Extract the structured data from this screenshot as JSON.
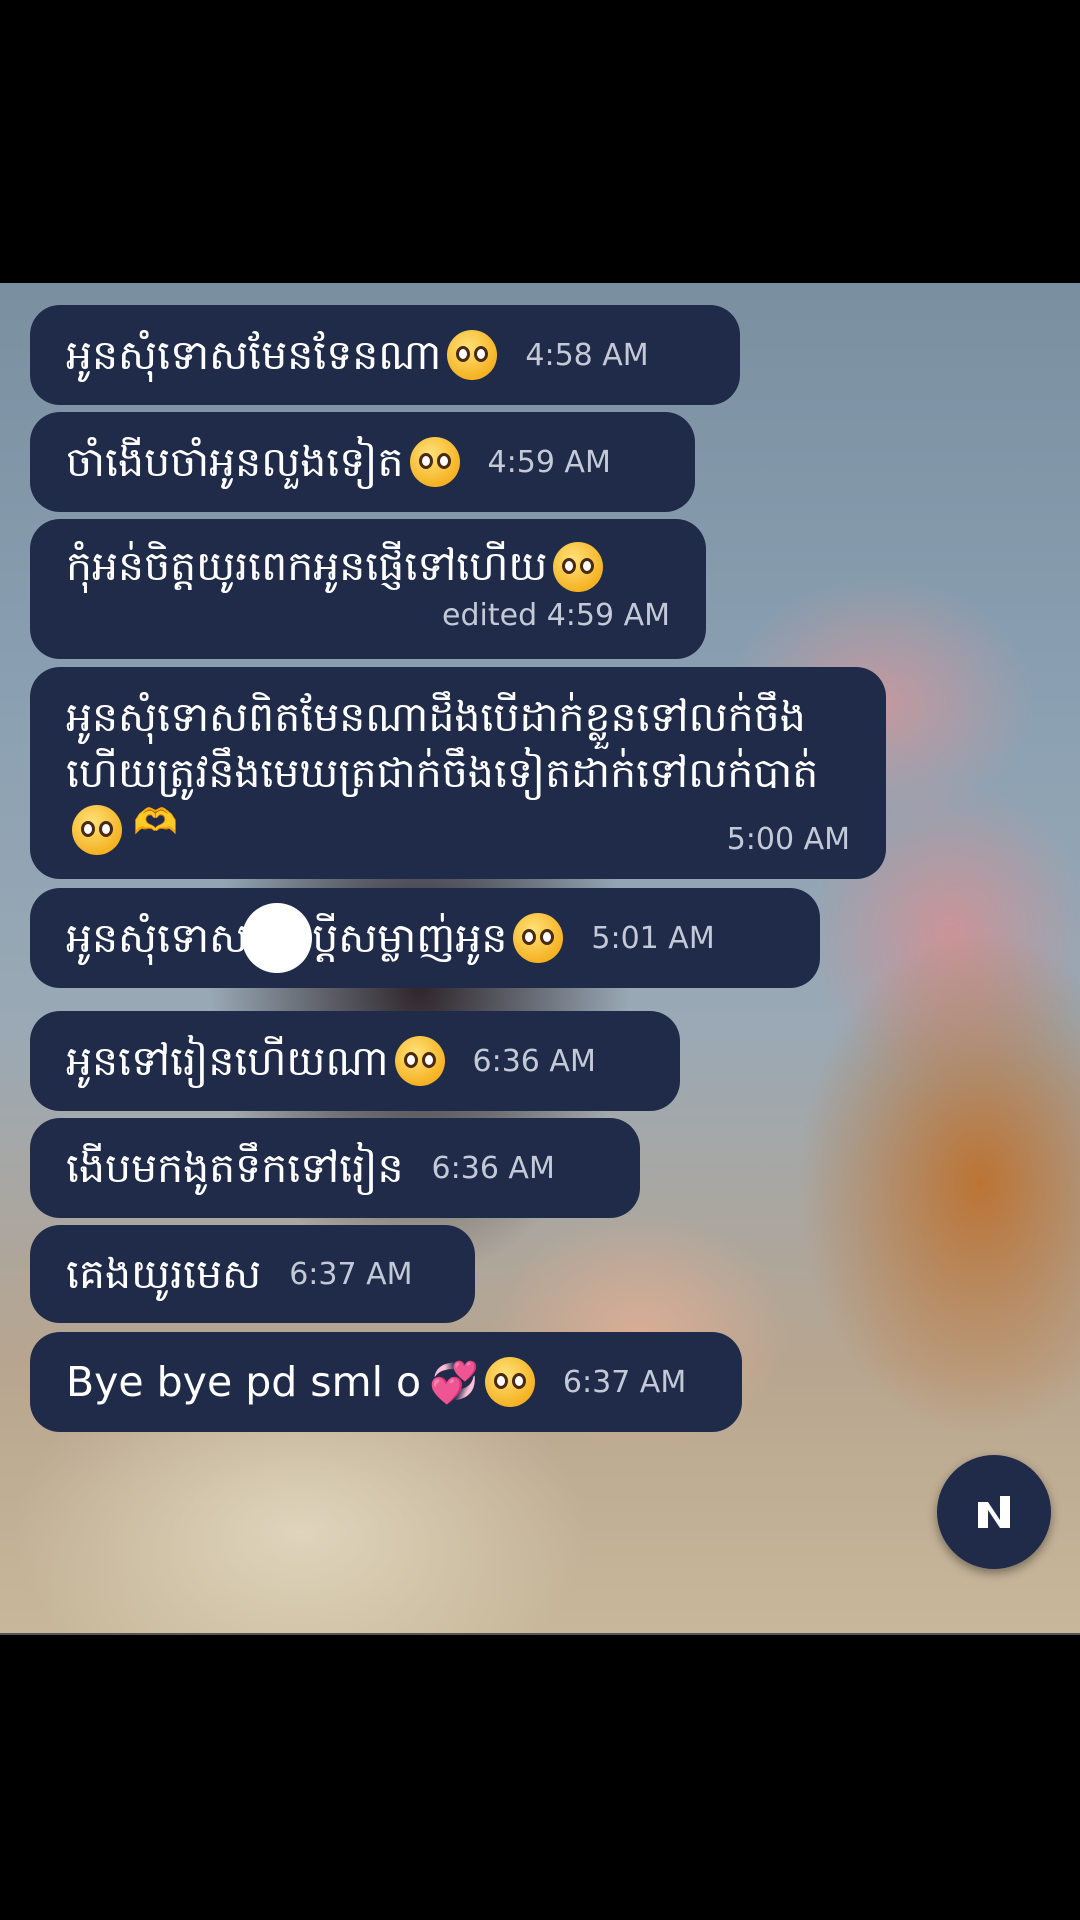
{
  "messages": [
    {
      "text": "អូនសុំទោសមែនទែនណា",
      "time": "4:58 AM"
    },
    {
      "text": "ចាំងើបចាំអូនលួងទៀត",
      "time": "4:59 AM"
    },
    {
      "text": "កុំអន់ចិត្តយូរពេកអូនផ្ញើទៅហើយ",
      "edited_label": "edited",
      "time": "4:59 AM"
    },
    {
      "text": "អូនសុំទោសពិតមែនណាដឹងបើដាក់ខ្លួនទៅលក់ចឹងហើយត្រូវនឹងមេឃត្រជាក់ចឹងទៀតដាក់ទៅលក់បាត់",
      "time": "5:00 AM"
    },
    {
      "text_before": "អូនសុំទោស",
      "text_after": "ប្ដីសម្លាញ់អូន",
      "time": "5:01 AM"
    },
    {
      "text": "អូនទៅរៀនហើយណា",
      "time": "6:36 AM"
    },
    {
      "text": "ងើបមកងូតទឹកទៅរៀន",
      "time": "6:36 AM"
    },
    {
      "text": "គេងយូរមេស",
      "time": "6:37 AM"
    },
    {
      "text": "Bye bye pd sml o",
      "time": "6:37 AM"
    }
  ],
  "icons": {
    "emoji": "pleading-face-icon",
    "heart": "two-hearts-icon",
    "hands": "heart-hands-icon",
    "fab": "app-logo-icon"
  },
  "colors": {
    "bubble": "#1f2b48",
    "time": "#c3c9d6"
  }
}
